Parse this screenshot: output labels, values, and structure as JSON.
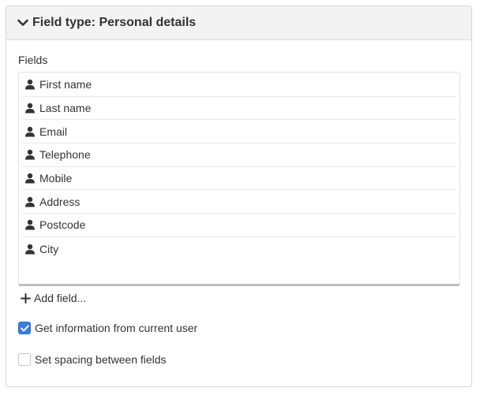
{
  "panel": {
    "title": "Field type: Personal details",
    "toggle_icon": "chevron-down-icon"
  },
  "fields": {
    "label": "Fields",
    "items": [
      {
        "label": "First name",
        "icon": "user-icon"
      },
      {
        "label": "Last name",
        "icon": "user-icon"
      },
      {
        "label": "Email",
        "icon": "user-icon"
      },
      {
        "label": "Telephone",
        "icon": "user-icon"
      },
      {
        "label": "Mobile",
        "icon": "user-icon"
      },
      {
        "label": "Address",
        "icon": "user-icon"
      },
      {
        "label": "Postcode",
        "icon": "user-icon"
      },
      {
        "label": "City",
        "icon": "user-icon"
      }
    ],
    "add_label": "Add field..."
  },
  "options": {
    "current_user": {
      "label": "Get information from current user",
      "checked": true
    },
    "spacing": {
      "label": "Set spacing between fields",
      "checked": false
    }
  },
  "colors": {
    "checkbox_accent": "#3b7ddd",
    "header_bg": "#f3f3f3"
  }
}
